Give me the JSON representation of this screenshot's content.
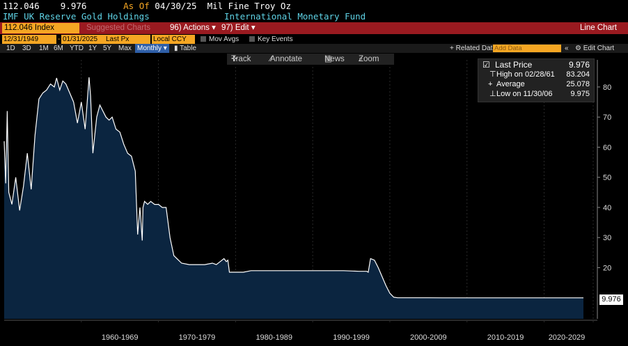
{
  "header": {
    "ticker_value": "112.046",
    "last_value": "9.976",
    "as_of_label": "As Of",
    "as_of_date": "04/30/25",
    "units": "Mil Fine Troy Oz",
    "name": "IMF UK Reserve Gold Holdings",
    "source": "International Monetary Fund"
  },
  "toolbar": {
    "security": "112.046 Index",
    "suggested": "Suggested Charts",
    "actions": "96) Actions",
    "edit": "97) Edit",
    "title": "Line Chart"
  },
  "toolbar2": {
    "start_date": "12/31/1949",
    "end_date": "01/31/2025",
    "field": "Last Px",
    "currency": "Local CCY",
    "mov_avgs": "Mov Avgs",
    "key_events": "Key Events"
  },
  "toolbar3": {
    "periods": [
      "1D",
      "3D",
      "1M",
      "6M",
      "YTD",
      "1Y",
      "5Y",
      "Max"
    ],
    "frequency": "Monthly",
    "table": "Table",
    "related": "Related Dat",
    "add_data": "Add Data",
    "edit_chart": "Edit Chart"
  },
  "trackbar": {
    "track": "Track",
    "annotate": "Annotate",
    "news": "News",
    "zoom": "Zoom"
  },
  "legend": {
    "last_price_label": "Last Price",
    "last_price_value": "9.976",
    "high_label": "High on 02/28/61",
    "high_value": "83.204",
    "average_label": "Average",
    "average_value": "25.078",
    "low_label": "Low on 11/30/06",
    "low_value": "9.975"
  },
  "last_flag": "9.976",
  "colors": {
    "background": "#000000",
    "area_fill": "#0b2540",
    "line": "#ffffff",
    "amber": "#f5a623",
    "cyan": "#5fd3e6",
    "toolbar_red": "#9a1a20"
  },
  "chart_data": {
    "type": "area",
    "ylim": [
      3,
      89
    ],
    "yticks": [
      20,
      30,
      40,
      50,
      60,
      70,
      80
    ],
    "xlim": [
      1950.0,
      2025.1
    ],
    "x_labels": [
      "1960-1969",
      "1970-1979",
      "1980-1989",
      "1990-1999",
      "2000-2009",
      "2010-2019",
      "2020-2029"
    ],
    "legend_position": "top-right",
    "series": [
      {
        "x": [
          1950.0,
          1950.2,
          1950.4,
          1950.6,
          1951.0,
          1951.5,
          1952.0,
          1952.5,
          1953.0,
          1953.5,
          1954.0,
          1954.5,
          1955.0,
          1955.5,
          1956.0,
          1956.5,
          1956.8,
          1957.2,
          1957.6,
          1958.0,
          1958.5,
          1959.0,
          1959.5,
          1960.0,
          1960.5,
          1961.0,
          1961.2,
          1961.5,
          1962.0,
          1962.4,
          1962.8,
          1963.2,
          1963.6,
          1964.0,
          1964.5,
          1965.0,
          1965.5,
          1966.0,
          1966.5,
          1967.0,
          1967.3,
          1967.6,
          1967.9,
          1968.0,
          1968.2,
          1968.6,
          1969.0,
          1969.5,
          1970.0,
          1970.5,
          1971.0,
          1971.5,
          1972.0,
          1973.0,
          1974.0,
          1975.0,
          1976.0,
          1977.0,
          1977.5,
          1978.0,
          1978.5,
          1978.8,
          1979.0,
          1979.2,
          1980.0,
          1981.0,
          1982.0,
          1983.0,
          1984.0,
          1986.0,
          1988.0,
          1990.0,
          1992.0,
          1994.0,
          1996.0,
          1997.0,
          1997.2,
          1997.5,
          1998.0,
          1998.5,
          1999.0,
          1999.5,
          2000.0,
          2000.5,
          2001.0,
          2001.5,
          2002.0,
          2003.0,
          2005.0,
          2006.9,
          2010.0,
          2015.0,
          2020.0,
          2025.1
        ],
        "y": [
          62,
          48,
          72,
          45,
          41,
          50,
          39,
          47,
          58,
          46,
          64,
          76,
          78,
          79,
          81,
          80,
          83,
          79,
          82,
          81,
          78,
          75,
          68,
          75,
          66,
          83.2,
          77,
          58,
          70,
          74,
          72,
          70,
          69,
          70,
          66,
          65,
          61,
          58,
          57,
          52,
          31,
          40,
          29,
          40,
          42,
          41,
          42,
          41,
          41,
          40,
          40,
          30,
          24,
          21.5,
          21,
          21,
          21,
          21.5,
          21,
          22,
          23,
          22,
          22.5,
          18.5,
          18.5,
          18.5,
          19,
          19,
          19,
          19,
          19,
          19,
          19,
          19,
          18.8,
          18.8,
          18.5,
          23,
          22.5,
          20,
          17,
          14,
          11.5,
          10.2,
          10,
          10,
          10,
          10,
          10,
          9.975,
          9.98,
          9.98,
          9.98,
          9.976
        ]
      }
    ]
  }
}
